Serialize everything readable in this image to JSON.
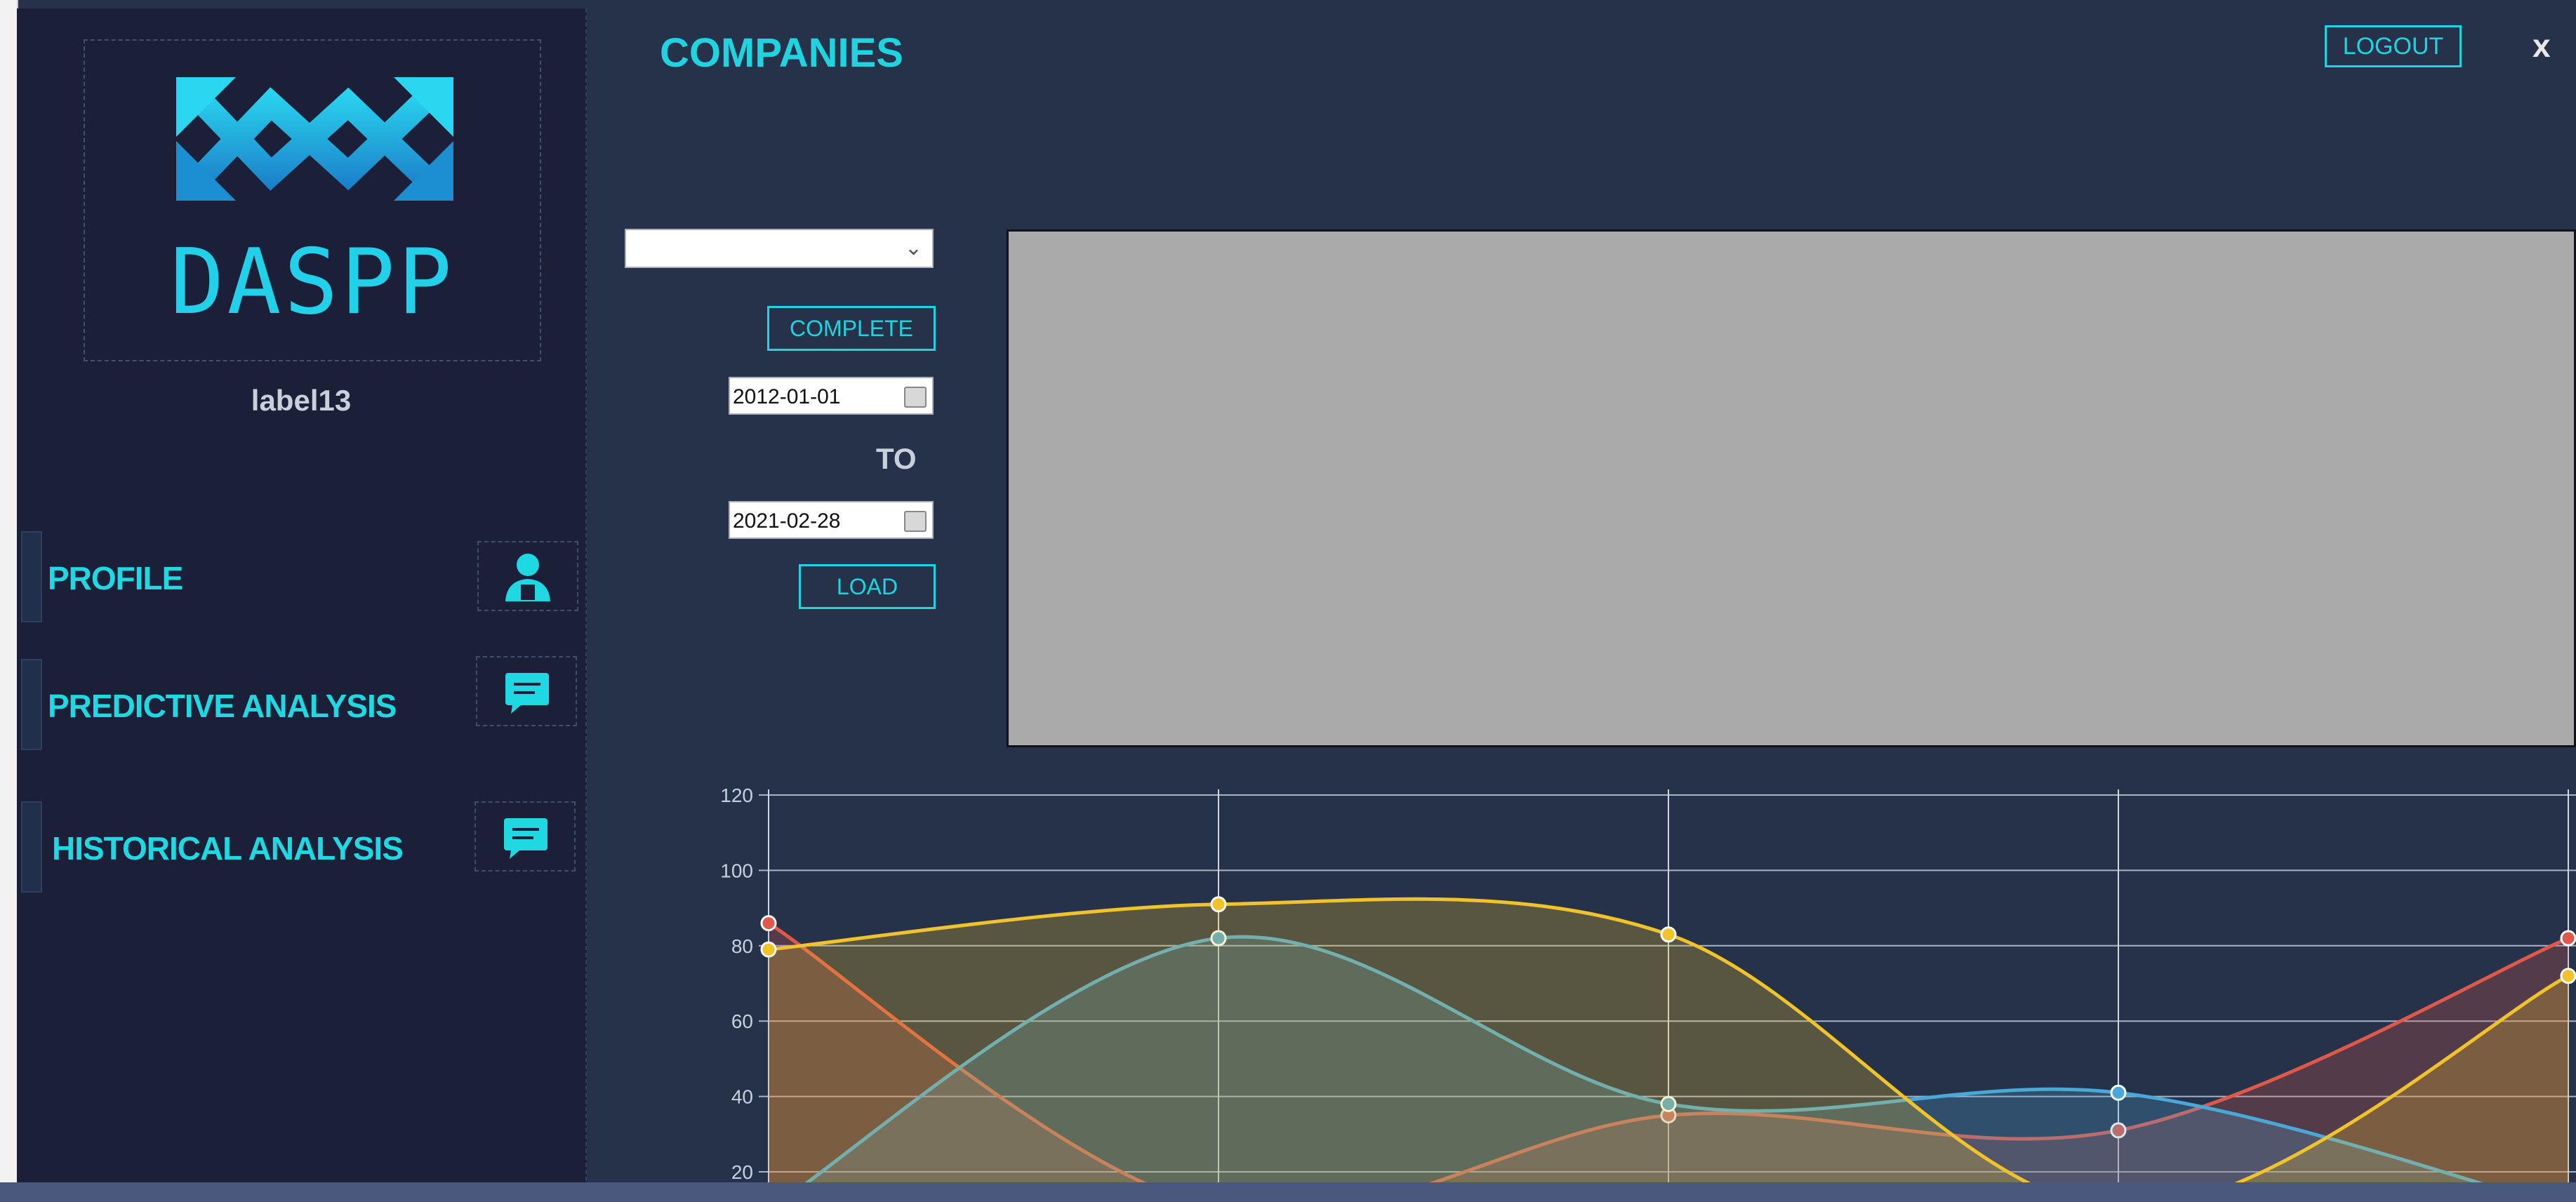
{
  "window": {
    "title": "COMPANIES",
    "logout_label": "LOGOUT",
    "close_glyph": "x"
  },
  "sidebar": {
    "logo_text": "DASPP",
    "user_label": "label13",
    "items": [
      {
        "label": "PROFILE",
        "icon": "user-icon"
      },
      {
        "label": "PREDICTIVE ANALYSIS",
        "icon": "chat-icon"
      },
      {
        "label": "HISTORICAL ANALYSIS",
        "icon": "chat-icon"
      }
    ]
  },
  "controls": {
    "company_select_value": "",
    "complete_label": "COMPLETE",
    "from_date": "2012-01-01",
    "to_label": "TO",
    "to_date": "2021-02-28",
    "load_label": "LOAD"
  },
  "colors": {
    "accent": "#1fd4e0",
    "red": "#e0584a",
    "blue": "#4aa8d8",
    "yellow": "#f0c22c"
  },
  "chart_data": {
    "type": "area",
    "ylim": [
      20,
      120
    ],
    "yticks": [
      "120",
      "100",
      "80",
      "60",
      "40",
      "20"
    ],
    "grid": true,
    "x": [
      0,
      1,
      2,
      3,
      4
    ],
    "series": [
      {
        "color": "#e0584a",
        "values": [
          86,
          10,
          35,
          31,
          82
        ]
      },
      {
        "color": "#4aa8d8",
        "values": [
          10,
          82,
          38,
          41,
          10
        ]
      },
      {
        "color": "#f0c22c",
        "values": [
          79,
          91,
          83,
          10,
          72
        ]
      }
    ]
  }
}
